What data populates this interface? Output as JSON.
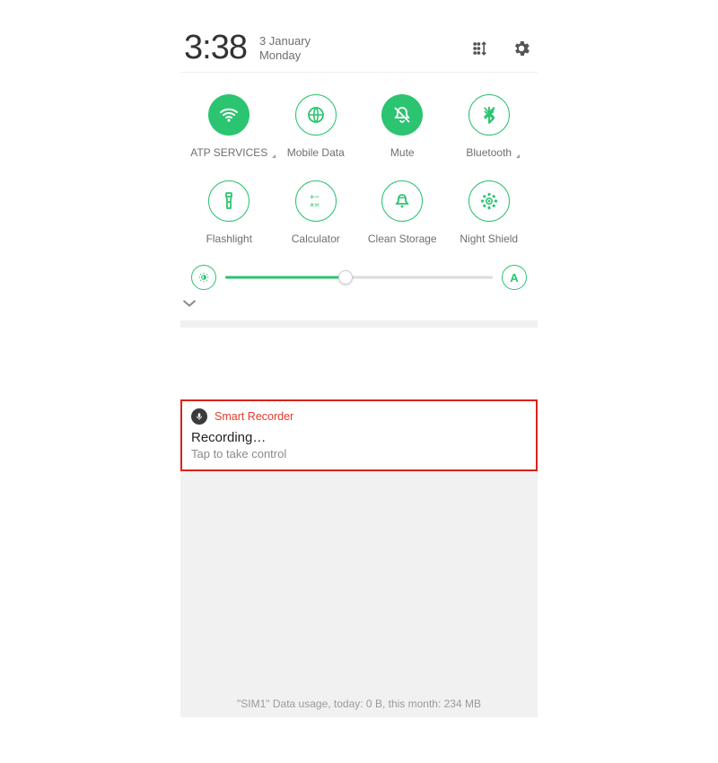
{
  "header": {
    "time": "3:38",
    "date_line1": "3 January",
    "date_line2": "Monday"
  },
  "tiles": [
    {
      "label": "ATP SERVICES",
      "icon": "wifi",
      "state": "filled",
      "expandable": true
    },
    {
      "label": "Mobile Data",
      "icon": "globe",
      "state": "outline",
      "expandable": false
    },
    {
      "label": "Mute",
      "icon": "mute-bell",
      "state": "filled",
      "expandable": false
    },
    {
      "label": "Bluetooth",
      "icon": "bluetooth",
      "state": "outline",
      "expandable": true
    },
    {
      "label": "Flashlight",
      "icon": "flashlight",
      "state": "outline",
      "expandable": false
    },
    {
      "label": "Calculator",
      "icon": "calculator",
      "state": "outline",
      "expandable": false
    },
    {
      "label": "Clean Storage",
      "icon": "clean-bell",
      "state": "outline",
      "expandable": false
    },
    {
      "label": "Night Shield",
      "icon": "night-sun",
      "state": "outline",
      "expandable": false
    }
  ],
  "brightness": {
    "percent": 45,
    "auto_label": "A"
  },
  "notification": {
    "app_name": "Smart Recorder",
    "title": "Recording…",
    "subtitle": "Tap to take control"
  },
  "footer": "\"SIM1\" Data usage, today: 0 B, this month: 234 MB",
  "colors": {
    "accent": "#2bc470",
    "highlight_border": "#d9241c"
  }
}
